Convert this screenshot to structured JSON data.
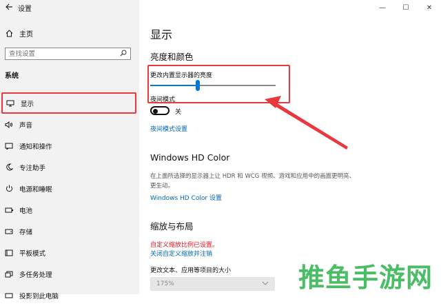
{
  "window": {
    "title": "设置",
    "controls": {
      "minimize": "—",
      "maximize": "☐",
      "close": "✕"
    }
  },
  "sidebar": {
    "home": "主页",
    "search_placeholder": "查找设置",
    "section": "系统",
    "items": [
      {
        "label": "显示",
        "icon": "monitor-icon"
      },
      {
        "label": "声音",
        "icon": "speaker-icon"
      },
      {
        "label": "通知和操作",
        "icon": "notification-icon"
      },
      {
        "label": "专注助手",
        "icon": "moon-icon"
      },
      {
        "label": "电源和睡眠",
        "icon": "power-icon"
      },
      {
        "label": "电池",
        "icon": "battery-icon"
      },
      {
        "label": "存储",
        "icon": "storage-icon"
      },
      {
        "label": "平板模式",
        "icon": "tablet-icon"
      },
      {
        "label": "多任务处理",
        "icon": "multitask-icon"
      },
      {
        "label": "投影到此电脑",
        "icon": "projector-icon"
      }
    ]
  },
  "main": {
    "title": "显示",
    "brightness": {
      "heading": "亮度和颜色",
      "slider_label": "更改内置显示器的亮度",
      "value_fraction": 0.38
    },
    "night_light": {
      "label": "夜间模式",
      "state": "关",
      "settings_link": "夜间模式设置"
    },
    "hd_color": {
      "heading": "Windows HD Color",
      "description": "在上面所选择的显示器上让 HDR 和 WCG 视频、游戏和应用中的画面更明亮、更生动。",
      "link": "Windows HD Color 设置"
    },
    "scale": {
      "heading": "缩放与布局",
      "warning": "自定义缩放比例已设置。",
      "link": "关闭自定义缩放并注销",
      "size_label": "更改文本、应用等项目的大小",
      "size_value": "175%"
    }
  },
  "watermark": "推鱼手游网",
  "colors": {
    "accent": "#0078d7",
    "highlight": "#e8393f",
    "link": "#0066b4",
    "warning": "#e81123"
  }
}
